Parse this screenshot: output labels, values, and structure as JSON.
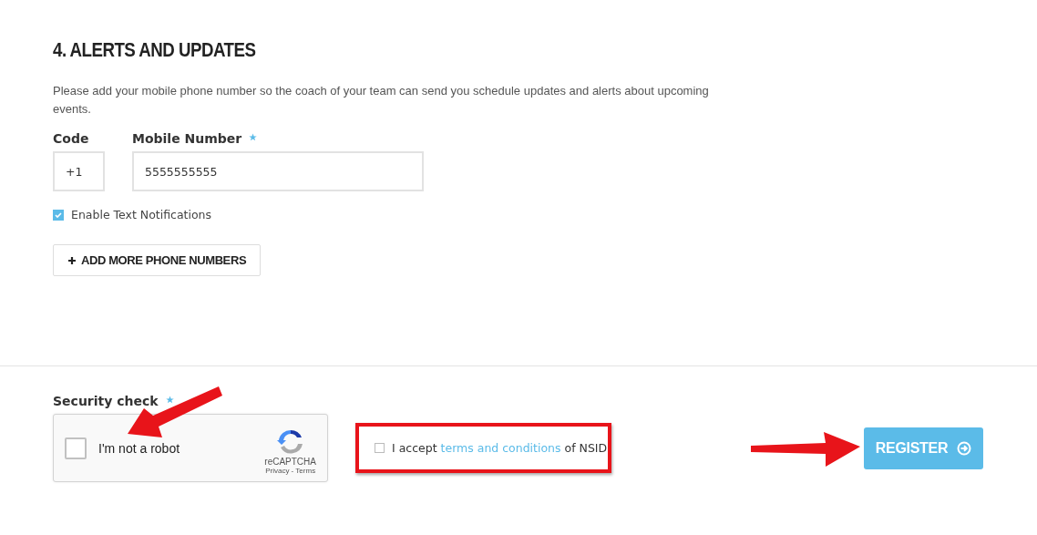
{
  "section": {
    "title": "4. ALERTS AND UPDATES",
    "description": "Please add your mobile phone number so the coach of your team can send you schedule updates and alerts about upcoming events."
  },
  "code_field": {
    "label": "Code",
    "value": "+1"
  },
  "mobile_field": {
    "label": "Mobile Number",
    "required": true,
    "value": "5555555555"
  },
  "notifications": {
    "label": "Enable Text Notifications",
    "checked": true
  },
  "add_button": {
    "label": "ADD MORE PHONE NUMBERS"
  },
  "security": {
    "label": "Security check",
    "required": true
  },
  "captcha": {
    "label": "I'm not a robot",
    "checked": false,
    "brand": "reCAPTCHA",
    "links": "Privacy - Terms"
  },
  "terms": {
    "before": "I accept",
    "link": "terms and conditions",
    "after": "of NSID",
    "checked": false,
    "highlighted": true
  },
  "register_button": {
    "label": "REGISTER"
  }
}
